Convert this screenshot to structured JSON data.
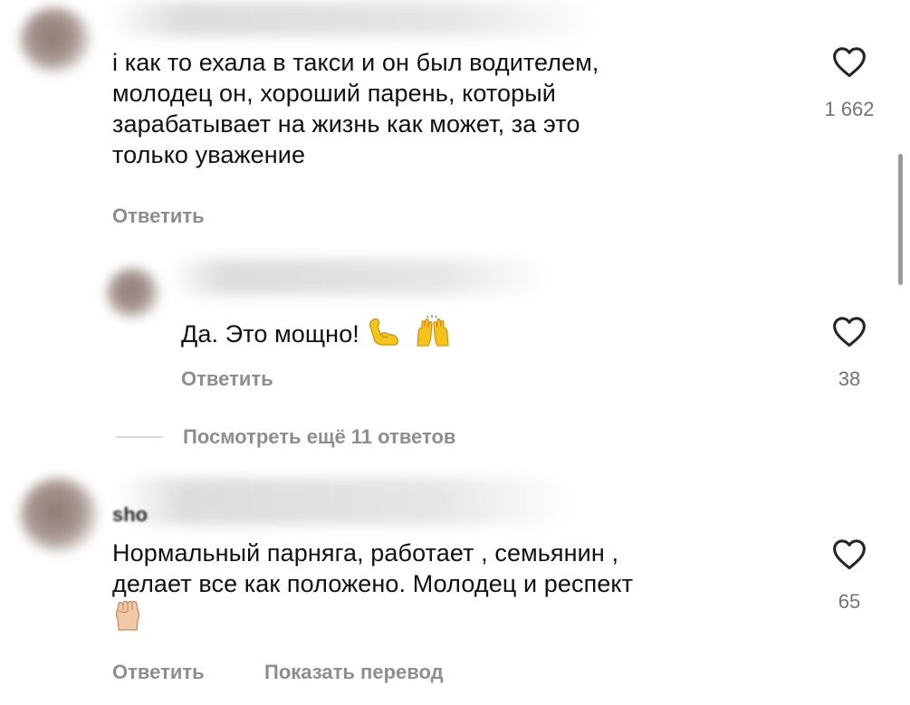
{
  "comments": [
    {
      "lines": [
        "і как то ехала в такси и он был водителем,",
        "молодец он, хороший парень, который",
        "зарабатывает на жизнь как может, за это",
        "только уважение"
      ],
      "reply_label": "Ответить",
      "likes": "1 662"
    },
    {
      "text": "Да. Это мощно!",
      "emoji": [
        "flexed-biceps",
        "raising-hands"
      ],
      "reply_label": "Ответить",
      "likes": "38",
      "partial_meta_visible": "· · ·"
    },
    {
      "username_partial": "sho",
      "lines": [
        "Нормальный парняга, работает , семьянин ,",
        "делает все как положено. Молодец и респект"
      ],
      "emoji": [
        "raised-fist"
      ],
      "reply_label": "Ответить",
      "translate_label": "Показать перевод",
      "likes": "65"
    }
  ],
  "view_replies_label": "Посмотреть ещё 11 ответов",
  "icons": {
    "like": "heart-outline-icon"
  },
  "colors": {
    "text": "#111111",
    "secondary": "#8e8e8e",
    "count": "#737373"
  }
}
